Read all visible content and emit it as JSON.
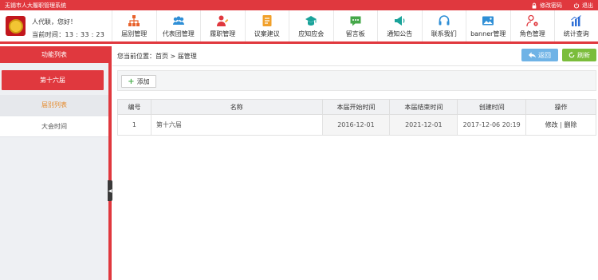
{
  "topbar": {
    "system_name": "无锡市人大履职管理系统",
    "change_password": "修改密码",
    "logout": "退出"
  },
  "header": {
    "greeting": "人代联，您好！",
    "time_label": "当前时间：",
    "time_value": "13 : 33 : 23"
  },
  "nav": [
    {
      "label": "届别管理",
      "icon": "org-chart-icon",
      "color": "#e8622c"
    },
    {
      "label": "代表团管理",
      "icon": "group-icon",
      "color": "#2f8fd6"
    },
    {
      "label": "履职管理",
      "icon": "person-edit-icon",
      "color": "#e0383e"
    },
    {
      "label": "议案建议",
      "icon": "document-icon",
      "color": "#f1a02a"
    },
    {
      "label": "应知应会",
      "icon": "graduation-cap-icon",
      "color": "#1aa39a"
    },
    {
      "label": "留言板",
      "icon": "chat-icon",
      "color": "#46a84a"
    },
    {
      "label": "通知公告",
      "icon": "megaphone-icon",
      "color": "#1aa39a"
    },
    {
      "label": "联系我们",
      "icon": "headset-icon",
      "color": "#2f8fd6"
    },
    {
      "label": "banner管理",
      "icon": "image-icon",
      "color": "#2f8fd6"
    },
    {
      "label": "角色管理",
      "icon": "user-gear-icon",
      "color": "#e0383e"
    },
    {
      "label": "统计查询",
      "icon": "bar-chart-icon",
      "color": "#2f6fd6"
    }
  ],
  "sidebar": {
    "title": "功能列表",
    "active_item": "第十六届",
    "items": [
      {
        "label": "届别列表"
      },
      {
        "label": "大会时间"
      }
    ]
  },
  "main": {
    "breadcrumb": "您当前位置：首页 > 届管理",
    "back_label": "返回",
    "refresh_label": "刷新",
    "add_label": "添加",
    "table": {
      "headers": [
        "编号",
        "名称",
        "本届开始时间",
        "本届结束时间",
        "创建时间",
        "操作"
      ],
      "rows": [
        {
          "id": "1",
          "name": "第十六届",
          "start": "2016-12-01",
          "end": "2021-12-01",
          "created": "2017-12-06 20:19",
          "edit": "修改",
          "sep": " | ",
          "delete": "删除"
        }
      ]
    }
  }
}
